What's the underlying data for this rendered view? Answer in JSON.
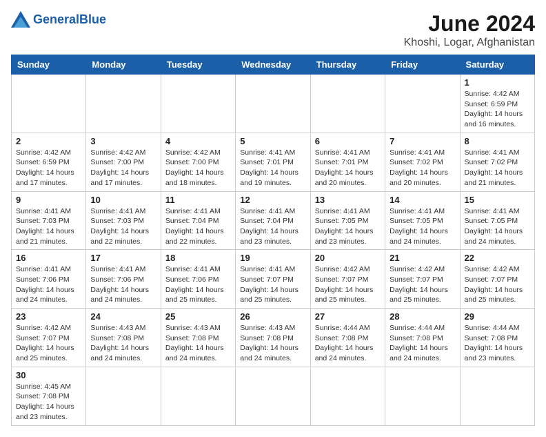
{
  "logo": {
    "text_general": "General",
    "text_blue": "Blue"
  },
  "title": "June 2024",
  "subtitle": "Khoshi, Logar, Afghanistan",
  "days_of_week": [
    "Sunday",
    "Monday",
    "Tuesday",
    "Wednesday",
    "Thursday",
    "Friday",
    "Saturday"
  ],
  "weeks": [
    [
      {
        "day": "",
        "info": ""
      },
      {
        "day": "",
        "info": ""
      },
      {
        "day": "",
        "info": ""
      },
      {
        "day": "",
        "info": ""
      },
      {
        "day": "",
        "info": ""
      },
      {
        "day": "",
        "info": ""
      },
      {
        "day": "1",
        "info": "Sunrise: 4:42 AM\nSunset: 6:59 PM\nDaylight: 14 hours and 16 minutes."
      }
    ],
    [
      {
        "day": "2",
        "info": "Sunrise: 4:42 AM\nSunset: 6:59 PM\nDaylight: 14 hours and 17 minutes."
      },
      {
        "day": "3",
        "info": "Sunrise: 4:42 AM\nSunset: 7:00 PM\nDaylight: 14 hours and 17 minutes."
      },
      {
        "day": "4",
        "info": "Sunrise: 4:42 AM\nSunset: 7:00 PM\nDaylight: 14 hours and 18 minutes."
      },
      {
        "day": "5",
        "info": "Sunrise: 4:41 AM\nSunset: 7:01 PM\nDaylight: 14 hours and 19 minutes."
      },
      {
        "day": "6",
        "info": "Sunrise: 4:41 AM\nSunset: 7:01 PM\nDaylight: 14 hours and 20 minutes."
      },
      {
        "day": "7",
        "info": "Sunrise: 4:41 AM\nSunset: 7:02 PM\nDaylight: 14 hours and 20 minutes."
      },
      {
        "day": "8",
        "info": "Sunrise: 4:41 AM\nSunset: 7:02 PM\nDaylight: 14 hours and 21 minutes."
      }
    ],
    [
      {
        "day": "9",
        "info": "Sunrise: 4:41 AM\nSunset: 7:03 PM\nDaylight: 14 hours and 21 minutes."
      },
      {
        "day": "10",
        "info": "Sunrise: 4:41 AM\nSunset: 7:03 PM\nDaylight: 14 hours and 22 minutes."
      },
      {
        "day": "11",
        "info": "Sunrise: 4:41 AM\nSunset: 7:04 PM\nDaylight: 14 hours and 22 minutes."
      },
      {
        "day": "12",
        "info": "Sunrise: 4:41 AM\nSunset: 7:04 PM\nDaylight: 14 hours and 23 minutes."
      },
      {
        "day": "13",
        "info": "Sunrise: 4:41 AM\nSunset: 7:05 PM\nDaylight: 14 hours and 23 minutes."
      },
      {
        "day": "14",
        "info": "Sunrise: 4:41 AM\nSunset: 7:05 PM\nDaylight: 14 hours and 24 minutes."
      },
      {
        "day": "15",
        "info": "Sunrise: 4:41 AM\nSunset: 7:05 PM\nDaylight: 14 hours and 24 minutes."
      }
    ],
    [
      {
        "day": "16",
        "info": "Sunrise: 4:41 AM\nSunset: 7:06 PM\nDaylight: 14 hours and 24 minutes."
      },
      {
        "day": "17",
        "info": "Sunrise: 4:41 AM\nSunset: 7:06 PM\nDaylight: 14 hours and 24 minutes."
      },
      {
        "day": "18",
        "info": "Sunrise: 4:41 AM\nSunset: 7:06 PM\nDaylight: 14 hours and 25 minutes."
      },
      {
        "day": "19",
        "info": "Sunrise: 4:41 AM\nSunset: 7:07 PM\nDaylight: 14 hours and 25 minutes."
      },
      {
        "day": "20",
        "info": "Sunrise: 4:42 AM\nSunset: 7:07 PM\nDaylight: 14 hours and 25 minutes."
      },
      {
        "day": "21",
        "info": "Sunrise: 4:42 AM\nSunset: 7:07 PM\nDaylight: 14 hours and 25 minutes."
      },
      {
        "day": "22",
        "info": "Sunrise: 4:42 AM\nSunset: 7:07 PM\nDaylight: 14 hours and 25 minutes."
      }
    ],
    [
      {
        "day": "23",
        "info": "Sunrise: 4:42 AM\nSunset: 7:07 PM\nDaylight: 14 hours and 25 minutes."
      },
      {
        "day": "24",
        "info": "Sunrise: 4:43 AM\nSunset: 7:08 PM\nDaylight: 14 hours and 24 minutes."
      },
      {
        "day": "25",
        "info": "Sunrise: 4:43 AM\nSunset: 7:08 PM\nDaylight: 14 hours and 24 minutes."
      },
      {
        "day": "26",
        "info": "Sunrise: 4:43 AM\nSunset: 7:08 PM\nDaylight: 14 hours and 24 minutes."
      },
      {
        "day": "27",
        "info": "Sunrise: 4:44 AM\nSunset: 7:08 PM\nDaylight: 14 hours and 24 minutes."
      },
      {
        "day": "28",
        "info": "Sunrise: 4:44 AM\nSunset: 7:08 PM\nDaylight: 14 hours and 24 minutes."
      },
      {
        "day": "29",
        "info": "Sunrise: 4:44 AM\nSunset: 7:08 PM\nDaylight: 14 hours and 23 minutes."
      }
    ],
    [
      {
        "day": "30",
        "info": "Sunrise: 4:45 AM\nSunset: 7:08 PM\nDaylight: 14 hours and 23 minutes."
      },
      {
        "day": "",
        "info": ""
      },
      {
        "day": "",
        "info": ""
      },
      {
        "day": "",
        "info": ""
      },
      {
        "day": "",
        "info": ""
      },
      {
        "day": "",
        "info": ""
      },
      {
        "day": "",
        "info": ""
      }
    ]
  ]
}
